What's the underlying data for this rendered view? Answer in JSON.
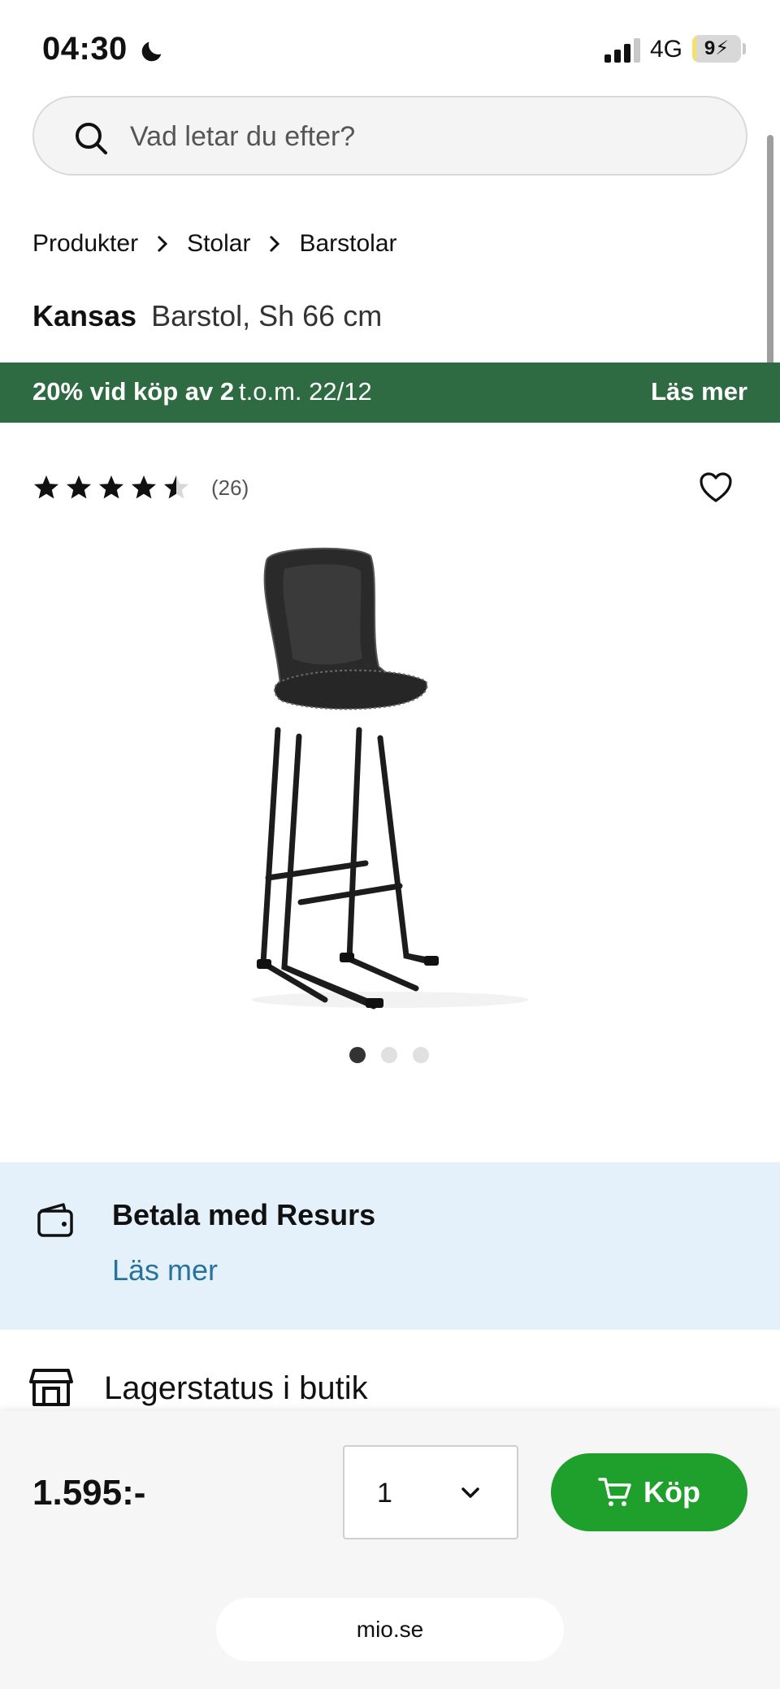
{
  "status_bar": {
    "time": "04:30",
    "network": "4G",
    "battery": "9",
    "battery_level": 0.09,
    "icons": [
      "moon-icon",
      "signal-icon",
      "battery-icon"
    ]
  },
  "search": {
    "placeholder": "Vad letar du efter?",
    "value": ""
  },
  "breadcrumb": {
    "items": [
      {
        "label": "Produkter"
      },
      {
        "label": "Stolar"
      },
      {
        "label": "Barstolar"
      }
    ]
  },
  "product": {
    "brand": "Kansas",
    "description": "Barstol, Sh 66 cm",
    "rating": 4.5,
    "review_count": "(26)",
    "image_count": 3,
    "active_image": 1
  },
  "promo": {
    "main": "20% vid köp av 2",
    "date": "t.o.m. 22/12",
    "link": "Läs mer",
    "color": "#2f6b42"
  },
  "payment": {
    "title": "Betala med Resurs",
    "link": "Läs mer",
    "link_color": "#27739e",
    "background": "#e4f1fb"
  },
  "stock": {
    "label": "Lagerstatus i butik"
  },
  "purchase": {
    "price": "1.595:-",
    "quantity": "1",
    "buy_label": "Köp",
    "button_color": "#1fa02c"
  },
  "browser": {
    "domain": "mio.se"
  }
}
